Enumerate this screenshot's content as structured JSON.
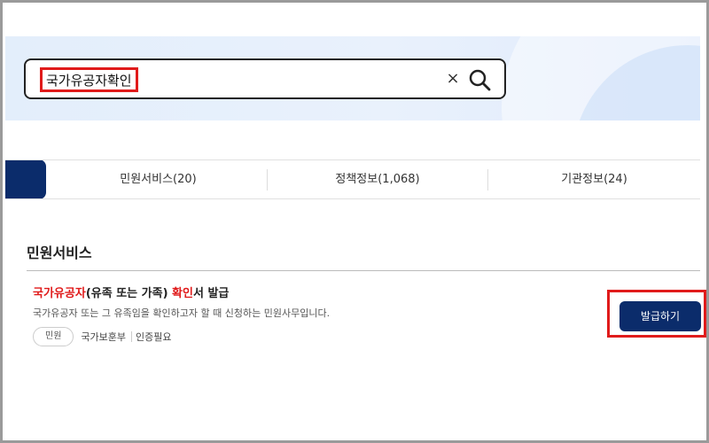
{
  "search": {
    "query": "국가유공자확인",
    "clear_label": "×"
  },
  "tabs": [
    {
      "label": "민원서비스(20)"
    },
    {
      "label": "정책정보(1,068)"
    },
    {
      "label": "기관정보(24)"
    }
  ],
  "section": {
    "title": "민원서비스"
  },
  "result": {
    "title_highlight_1": "국가유공자",
    "title_middle": "(유족 또는 가족) ",
    "title_highlight_2": "확인",
    "title_end": "서 발급",
    "description": "국가유공자 또는 그 유족임을 확인하고자 할 때 신청하는 민원사무입니다.",
    "badge": "민원",
    "agency": "국가보훈부",
    "auth": "인증필요",
    "button_label": "발급하기"
  },
  "colors": {
    "accent_navy": "#0b2c6b",
    "highlight_red": "#e01b1b"
  },
  "icons": {
    "search": "search-icon",
    "clear": "close-icon"
  }
}
